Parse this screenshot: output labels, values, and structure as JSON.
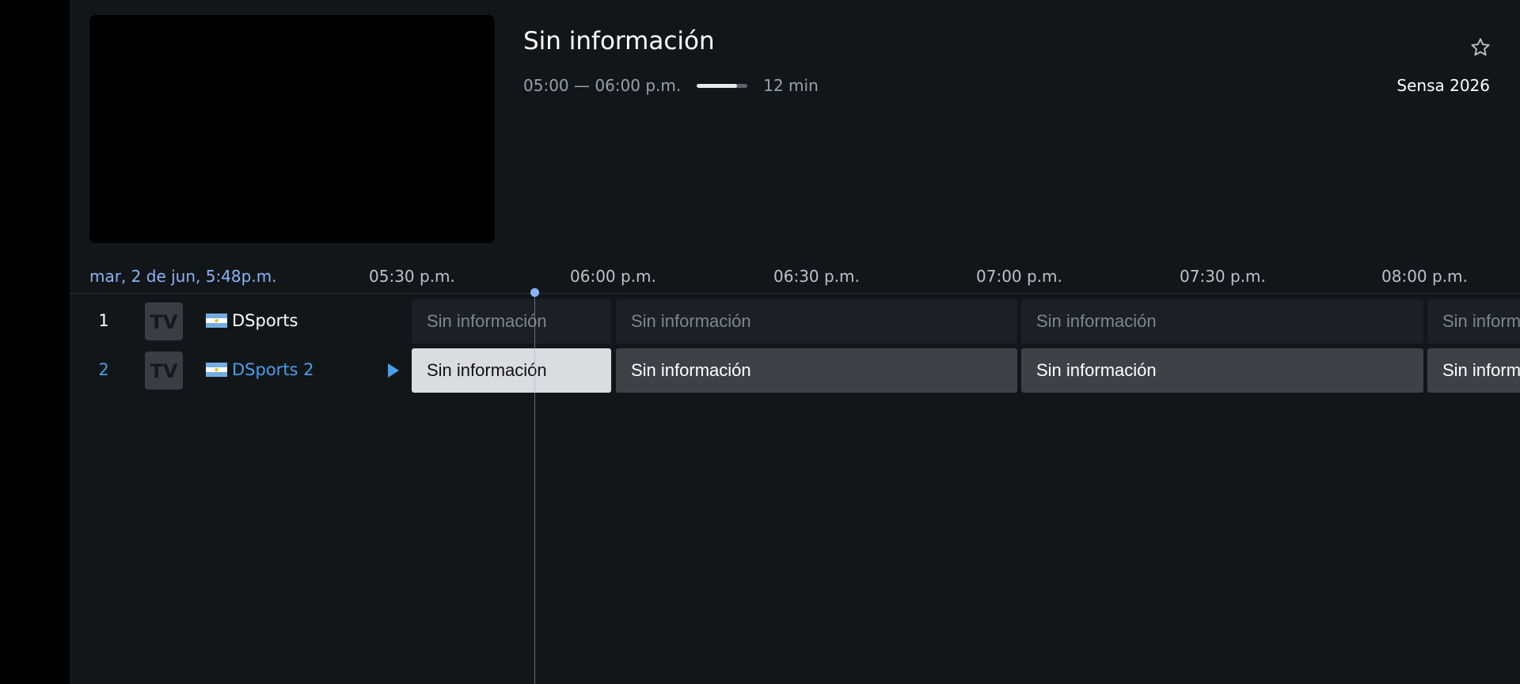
{
  "program": {
    "title": "Sin información",
    "time_range": "05:00 — 06:00 p.m.",
    "progress": 0.8,
    "remaining": "12 min"
  },
  "channel_brand": "Sensa 2026",
  "favorite_icon": "star-outline-icon",
  "timeline": {
    "now_label": "mar, 2 de jun, 5:48p.m.",
    "times": [
      "05:30 p.m.",
      "06:00 p.m.",
      "06:30 p.m.",
      "07:00 p.m.",
      "07:30 p.m.",
      "08:00 p.m."
    ]
  },
  "channels": [
    {
      "number": "1",
      "logo_text": "TV",
      "name": "DSports",
      "programs": [
        "Sin información",
        "Sin información",
        "Sin información",
        "Sin información"
      ]
    },
    {
      "number": "2",
      "logo_text": "TV",
      "name": "DSports 2",
      "programs": [
        "Sin información",
        "Sin información",
        "Sin información",
        "Sin información"
      ]
    }
  ],
  "colors": {
    "accent": "#8ab4f8",
    "background": "#131619",
    "selected_cell": "#dadce0",
    "active_channel": "#4a9eea"
  }
}
